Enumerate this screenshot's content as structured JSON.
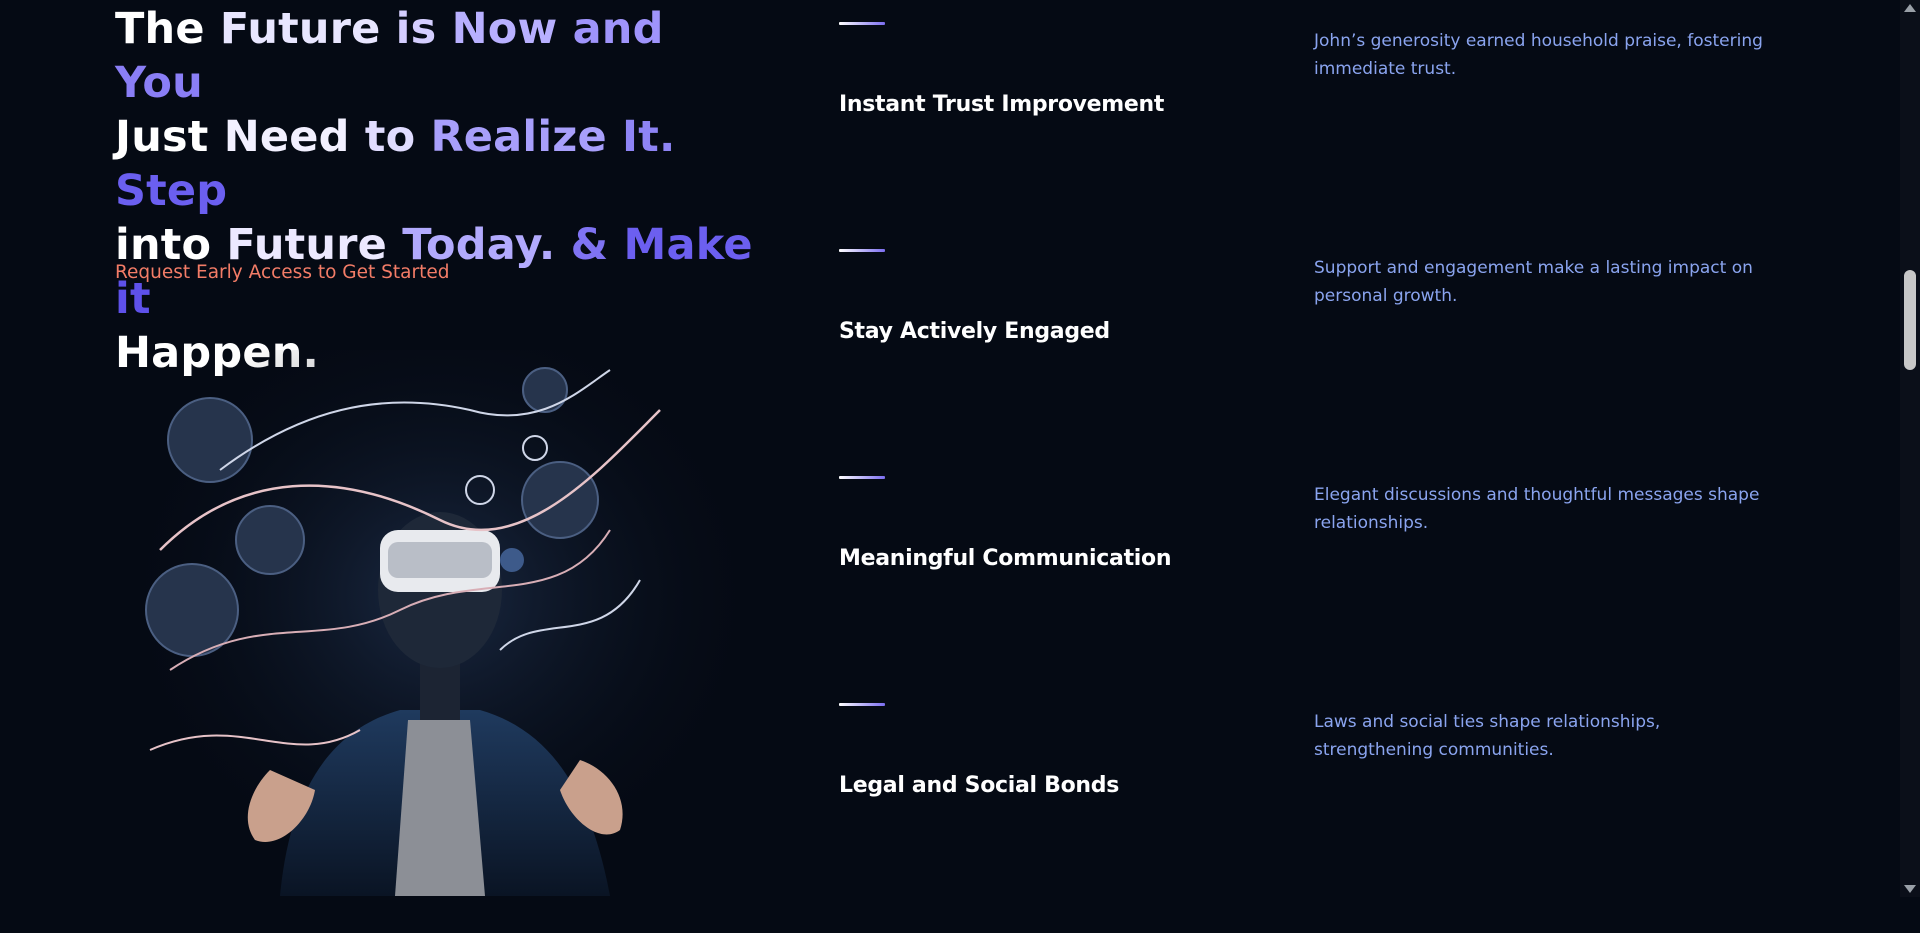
{
  "hero": {
    "headline": [
      {
        "text": "The ",
        "color": "#ffffff"
      },
      {
        "text": "Future ",
        "color": "#e8e6ff"
      },
      {
        "text": "is ",
        "color": "#d4ceff"
      },
      {
        "text": "Now ",
        "color": "#b8b0ff"
      },
      {
        "text": "and ",
        "color": "#9f94fb"
      },
      {
        "text": "You ",
        "color": "#8a7ef6"
      },
      {
        "text": "Just ",
        "color": "#ffffff"
      },
      {
        "text": "Need ",
        "color": "#f2f0ff"
      },
      {
        "text": "to ",
        "color": "#e0dcff"
      },
      {
        "text": "Realize ",
        "color": "#a89ffb"
      },
      {
        "text": "It. ",
        "color": "#8e84f5"
      },
      {
        "text": "Step ",
        "color": "#6b5ff0"
      },
      {
        "text": "into ",
        "color": "#ffffff"
      },
      {
        "text": "Future ",
        "color": "#ece9ff"
      },
      {
        "text": "Today. ",
        "color": "#b2aafd"
      },
      {
        "text": "& ",
        "color": "#7f73f3"
      },
      {
        "text": "Make ",
        "color": "#6c5ff0"
      },
      {
        "text": "it ",
        "color": "#5e51ea"
      },
      {
        "text": "Happen.",
        "color": "#ffffff"
      }
    ],
    "cta": "Request Early Access to Get Started"
  },
  "features": [
    {
      "title": "Instant Trust Improvement",
      "desc": "John’s generosity earned household praise, fostering immediate trust."
    },
    {
      "title": "Stay Actively Engaged",
      "desc": "Support and engagement make a lasting impact on personal growth."
    },
    {
      "title": "Meaningful Communication",
      "desc": "Elegant discussions and thoughtful messages shape relationships."
    },
    {
      "title": "Legal and Social Bonds",
      "desc": "Laws and social ties shape relationships, strengthening communities."
    }
  ]
}
